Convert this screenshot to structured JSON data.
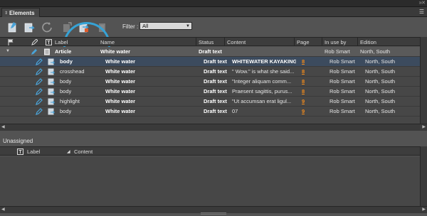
{
  "panel": {
    "tab_label": "Elements",
    "collapse_glyph": "⇕",
    "menu_glyph": "☰"
  },
  "toolbar": {
    "icons": [
      "new-element-icon",
      "export-icon",
      "refresh-icon",
      "detach-icon",
      "check-in-icon",
      "check-out-icon"
    ],
    "filter_label": "Filter :",
    "filter_value": "All"
  },
  "grid": {
    "headers": {
      "label": "Label",
      "name": "Name",
      "status": "Status",
      "content": "Content",
      "page": "Page",
      "in_use_by": "In use by",
      "edition": "Edition"
    },
    "article": {
      "label": "Article",
      "name": "White water",
      "status": "Draft text",
      "in_use_by": "Rob Smart",
      "edition": "North, South"
    },
    "rows": [
      {
        "label": "body",
        "name": "White water",
        "status": "Draft text",
        "content": "WHITEWATER KAYAKING",
        "page": "8",
        "in_use_by": "Rob Smart",
        "edition": "North, South"
      },
      {
        "label": "crosshead",
        "name": "White water",
        "status": "Draft text",
        "content": "\" Wow.\" is what she said...",
        "page": "8",
        "in_use_by": "Rob Smart",
        "edition": "North, South"
      },
      {
        "label": "body",
        "name": "White water",
        "status": "Draft text",
        "content": "\"Integer aliquam comm...",
        "page": "8",
        "in_use_by": "Rob Smart",
        "edition": "North, South"
      },
      {
        "label": "body",
        "name": "White water",
        "status": "Draft text",
        "content": "Praesent sagittis, purus...",
        "page": "8",
        "in_use_by": "Rob Smart",
        "edition": "North, South"
      },
      {
        "label": "highlight",
        "name": "White water",
        "status": "Draft text",
        "content": "\"Ut accumsan erat ligul...",
        "page": "9",
        "in_use_by": "Rob Smart",
        "edition": "North, South"
      },
      {
        "label": "body",
        "name": "White water",
        "status": "Draft text",
        "content": "07",
        "page": "9",
        "in_use_by": "Rob Smart",
        "edition": "North, South"
      }
    ]
  },
  "unassigned": {
    "title": "Unassigned",
    "headers": {
      "label": "Label",
      "content": "Content"
    }
  },
  "colors": {
    "highlight_ring": "#36a3d6",
    "page_link": "#f08a1c",
    "selected_row": "#3c4b5e"
  }
}
